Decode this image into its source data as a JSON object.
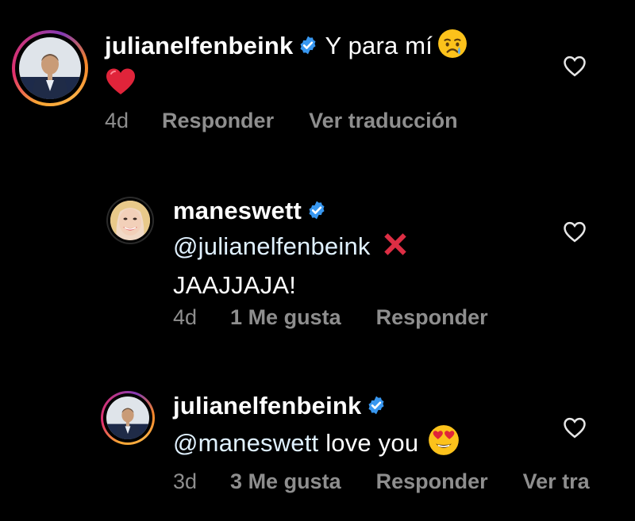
{
  "comments": [
    {
      "username": "julianelfenbeink",
      "text": "Y para mí",
      "time": "4d",
      "likes": "",
      "reply_label": "Responder",
      "translate_label": "Ver traducción"
    },
    {
      "username": "maneswett",
      "mention": "@julianelfenbeink",
      "text": "JAAJJAJA!",
      "time": "4d",
      "likes": "1 Me gusta",
      "reply_label": "Responder"
    },
    {
      "username": "julianelfenbeink",
      "mention": "@maneswett",
      "text": "love you",
      "time": "3d",
      "likes": "3 Me gusta",
      "reply_label": "Responder",
      "translate_label": "Ver tra"
    }
  ],
  "colors": {
    "background": "#000000",
    "text": "#ffffff",
    "meta": "#8e8e8e",
    "verified": "#3897f0"
  },
  "icons": {
    "verified": "verified-badge-icon",
    "like": "heart-outline-icon",
    "emoji_crying": "crying-face-emoji",
    "emoji_heart": "red-heart-emoji",
    "emoji_cross": "cross-mark-emoji",
    "emoji_heart_eyes": "heart-eyes-emoji"
  }
}
